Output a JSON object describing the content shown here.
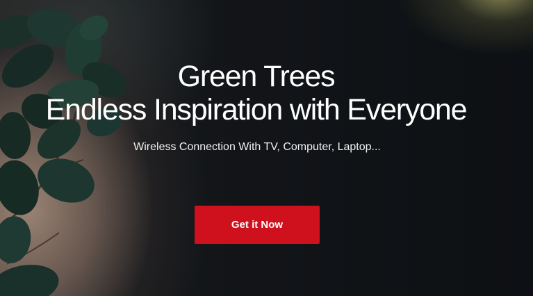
{
  "hero": {
    "title_line_1": "Green Trees",
    "title_line_2": "Endless Inspiration with Everyone",
    "subtitle": "Wireless Connection With TV, Computer, Laptop...",
    "cta_label": "Get it Now",
    "cta_color": "#cf101d",
    "text_color": "#ffffff"
  }
}
